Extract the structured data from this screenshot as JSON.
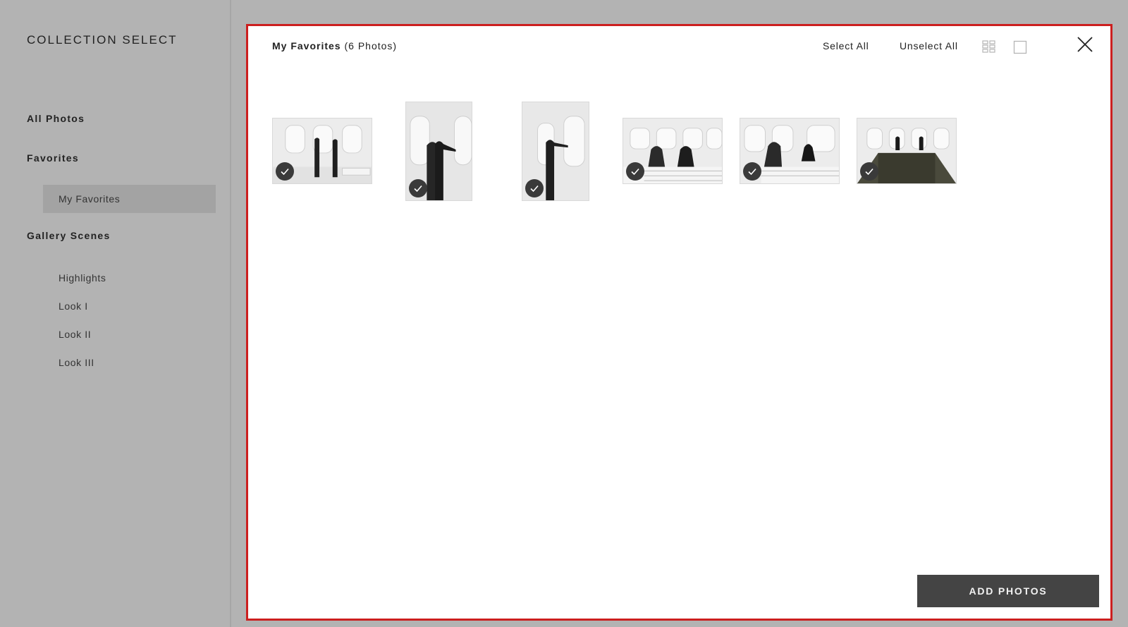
{
  "sidebar": {
    "brand": "COLLECTION SELECT",
    "all_photos": "All Photos",
    "favorites": "Favorites",
    "my_favorites": "My Favorites",
    "gallery_scenes": "Gallery Scenes",
    "scenes": [
      "Highlights",
      "Look I",
      "Look II",
      "Look III"
    ]
  },
  "panel": {
    "title": "My Favorites",
    "count": "(6 Photos)",
    "select_all": "Select All",
    "unselect_all": "Unselect All",
    "grid_view_icon": "grid-view-icon",
    "single_view_icon": "single-view-icon",
    "close_icon": "close-icon",
    "add_button": "ADD PHOTOS"
  },
  "photos": [
    {
      "orientation": "landscape",
      "selected": true
    },
    {
      "orientation": "portrait",
      "selected": true
    },
    {
      "orientation": "portrait",
      "selected": true
    },
    {
      "orientation": "landscape",
      "selected": true
    },
    {
      "orientation": "landscape",
      "selected": true
    },
    {
      "orientation": "landscape",
      "selected": true
    }
  ],
  "colors": {
    "background": "#b3b3b3",
    "active_nav": "#a3a3a3",
    "panel_border": "#cc1f1f",
    "button": "#444444"
  }
}
